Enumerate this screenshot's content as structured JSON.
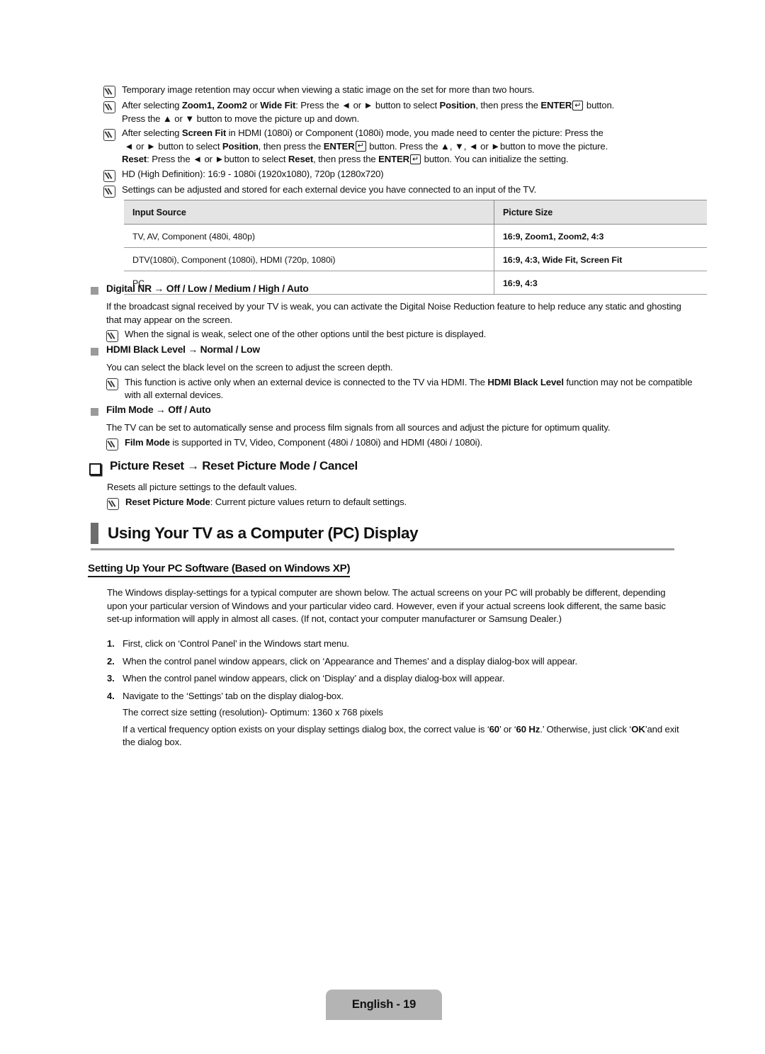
{
  "page": {
    "footer_label": "English - 19",
    "accent_gray": "#9a9a9a",
    "header_row_bg": "#e4e4e4",
    "badge_bg": "#b4b4b4"
  },
  "top_notes": [
    {
      "id": "note-image-retention",
      "lines": [
        "Temporary image retention may occur when viewing a static image on the set for more than two hours."
      ]
    },
    {
      "id": "note-zoom-position",
      "lines": [
        "After selecting Zoom1, Zoom2 or Wide Fit: Press the ◄ or ► button to select Position, then press the ENTER↵ button.",
        "Press the ▲ or ▼ button to move the picture up and down."
      ]
    },
    {
      "id": "note-screen-fit",
      "lines": [
        "After selecting Screen Fit in HDMI (1080i) or Component (1080i) mode, you made need to center the picture: Press the",
        "◄ or ► button to select Position, then press the ENTER↵ button. Press the ▲, ▼, ◄ or ► button to move the picture.",
        "Reset: Press the ◄ or ► button to select Reset, then press the ENTER↵ button. You can initialize the setting."
      ]
    },
    {
      "id": "note-hd-definition",
      "lines": [
        "HD (High Definition): 16:9 - 1080i (1920x1080), 720p (1280x720)"
      ]
    },
    {
      "id": "note-settings-stored",
      "lines": [
        "Settings can be adjusted and stored for each external device you have connected to an input of the TV."
      ]
    }
  ],
  "size_table": {
    "headers": [
      "Input Source",
      "Picture Size"
    ],
    "rows": [
      [
        "TV, AV, Component (480i, 480p)",
        "16:9, Zoom1, Zoom2, 4:3"
      ],
      [
        "DTV(1080i), Component (1080i), HDMI (720p, 1080i)",
        "16:9, 4:3, Wide Fit, Screen Fit"
      ],
      [
        "PC",
        "16:9, 4:3"
      ]
    ]
  },
  "settings": [
    {
      "id": "digital-nr",
      "heading": "Digital NR → Off / Low / Medium / High / Auto",
      "paragraph": "If the broadcast signal received by your TV is weak, you can activate the Digital Noise Reduction feature to help reduce any static and ghosting that may appear on the screen.",
      "notes": [
        "When the signal is weak, select one of the other options until the best picture is displayed."
      ]
    },
    {
      "id": "hdmi-black-level",
      "heading": "HDMI Black Level → Normal / Low",
      "paragraph": "You can select the black level on the screen to adjust the screen depth.",
      "notes": [
        "This function is active only when an external device is connected to the TV via HDMI. The HDMI Black Level function may not be compatible with all external devices."
      ]
    },
    {
      "id": "film-mode",
      "heading": "Film Mode → Off / Auto",
      "paragraph": "The TV can be set to automatically sense and process film signals from all sources and adjust the picture for optimum quality.",
      "notes": [
        "Film Mode is supported in TV, Video, Component (480i / 1080i) and HDMI (480i / 1080i)."
      ]
    }
  ],
  "picture_reset": {
    "heading": "Picture Reset → Reset Picture Mode / Cancel",
    "paragraph": "Resets all picture settings to the default values.",
    "note_bold": "Reset Picture Mode",
    "note_rest": ": Current picture values return to default settings."
  },
  "chapter": {
    "title": "Using Your TV as a Computer (PC) Display"
  },
  "pc_section": {
    "heading": "Setting Up Your PC Software (Based on Windows XP)",
    "intro": "The Windows display-settings for a typical computer are shown below. The actual screens on your PC will probably be different, depending upon your particular version of Windows and your particular video card. However, even if your actual screens look different, the same basic set-up information will apply in almost all cases. (If not, contact your computer manufacturer or Samsung Dealer.)",
    "steps": [
      {
        "num": "1.",
        "text": "First, click on ‘Control Panel’ in the Windows start menu."
      },
      {
        "num": "2.",
        "text": "When the control panel window appears, click on ‘Appearance and Themes’ and a display dialog-box will appear."
      },
      {
        "num": "3.",
        "text": "When the control panel window appears, click on ‘Display’ and a display dialog-box will appear."
      },
      {
        "num": "4.",
        "text": "Navigate to the ‘Settings’ tab on the display dialog-box."
      }
    ],
    "step4_extra_1": "The correct size setting (resolution)- Optimum: 1360 x 768 pixels",
    "step4_extra_2_a": "If a vertical frequency option exists on your display settings dialog box, the correct value is ‘",
    "step4_extra_2_b": "60",
    "step4_extra_2_c": "’ or ‘",
    "step4_extra_2_d": "60 Hz",
    "step4_extra_2_e": ".’ Otherwise, just click ‘",
    "step4_extra_2_f": "OK",
    "step4_extra_2_g": "’and exit the dialog box."
  }
}
